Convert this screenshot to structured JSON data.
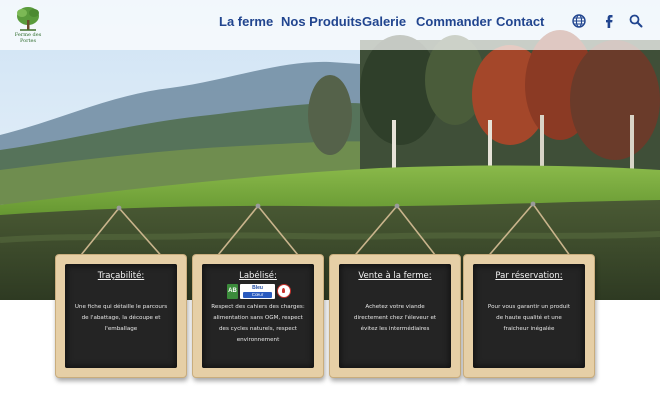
{
  "header": {
    "logo_text": "Ferme des Portes",
    "nav": [
      {
        "label": "La ferme"
      },
      {
        "label": "Nos Produits"
      },
      {
        "label": "Galerie"
      },
      {
        "label": "Commander"
      },
      {
        "label": "Contact"
      }
    ],
    "icons": [
      "globe-icon",
      "facebook-icon",
      "search-icon"
    ],
    "nav_color": "#21458f"
  },
  "boards": [
    {
      "title": "Traçabilité:",
      "lines": [
        "Une fiche qui détaille le parcours",
        "de l'abattage, la découpe et",
        "l'emballage"
      ]
    },
    {
      "title": "Labélisé:",
      "badges": [
        "AB",
        "Bleu Blanc Cœur",
        "Sans OGM"
      ],
      "badge_ab_label": "AB",
      "badge_bleu_top": "Bleu",
      "badge_bleu_bottom": "Cœur",
      "lines": [
        "Respect des cahiers des charges:",
        "alimentation sans OGM, respect",
        "des cycles naturels, respect",
        "environnement"
      ]
    },
    {
      "title": "Vente à la ferme:",
      "lines": [
        "Achetez votre viande",
        "directement chez l'éleveur et",
        "évitez les intermédiaires"
      ]
    },
    {
      "title": "Par réservation:",
      "lines": [
        "Pour vous garantir un produit",
        "de haute qualité et une",
        "fraicheur inégalée"
      ]
    }
  ]
}
